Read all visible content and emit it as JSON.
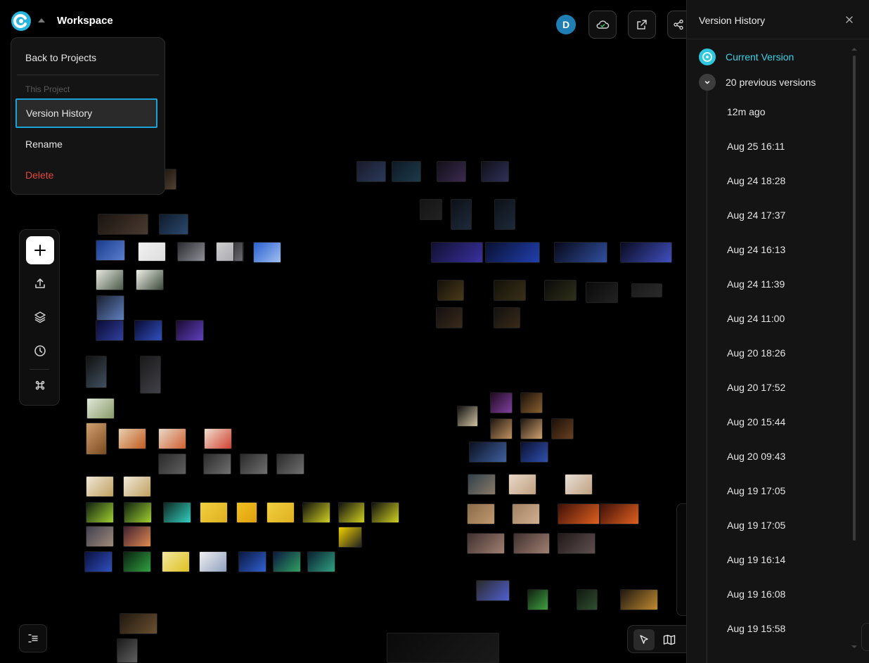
{
  "header": {
    "workspace_title": "Workspace",
    "avatar_initial": "D"
  },
  "menu": {
    "back": "Back to Projects",
    "section": "This Project",
    "version_history": "Version History",
    "rename": "Rename",
    "delete": "Delete"
  },
  "toolbar": {
    "items": [
      "add-icon",
      "upload-icon",
      "layers-icon",
      "history-icon",
      "command-icon"
    ]
  },
  "panel": {
    "title": "Version History",
    "current": "Current Version",
    "previous_label": "20 previous versions",
    "versions": [
      "12m ago",
      "Aug 25 16:11",
      "Aug 24 18:28",
      "Aug 24 17:37",
      "Aug 24 16:13",
      "Aug 24 11:39",
      "Aug 24 11:00",
      "Aug 20 18:26",
      "Aug 20 17:52",
      "Aug 20 15:44",
      "Aug 20 09:43",
      "Aug 19 17:05",
      "Aug 19 17:05",
      "Aug 19 16:14",
      "Aug 19 16:08",
      "Aug 19 15:58"
    ]
  },
  "colors": {
    "accent": "#2fc7de",
    "selection_border": "#1aa3d8",
    "danger": "#e0483e",
    "avatar": "#1f7fb5"
  }
}
